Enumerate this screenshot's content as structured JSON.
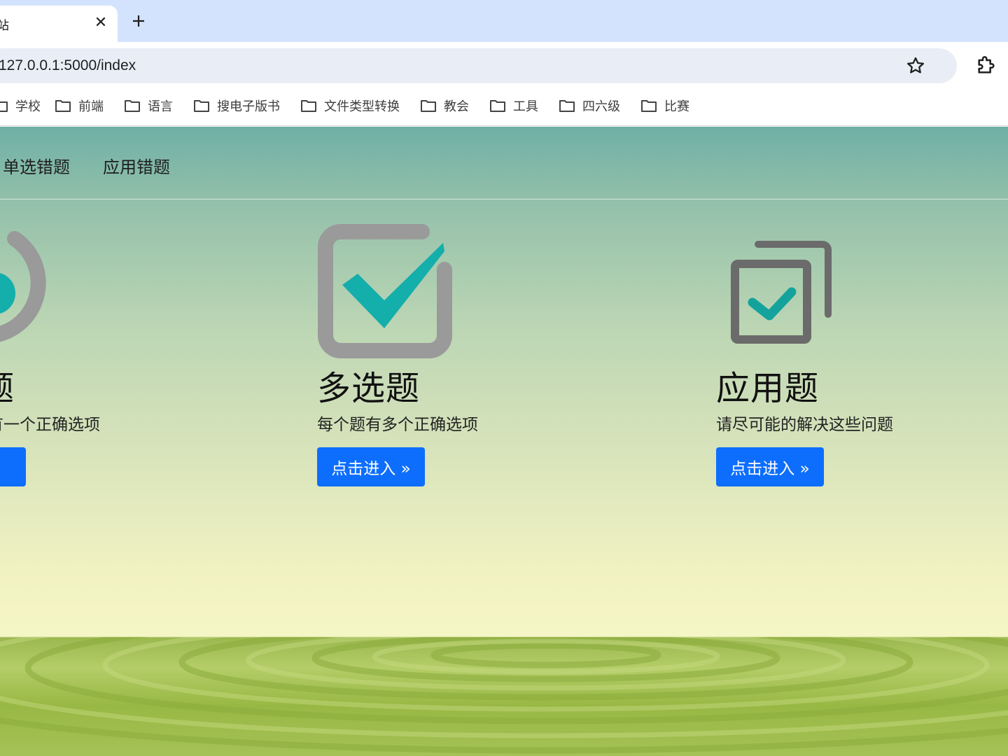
{
  "browser": {
    "tab_title": "站",
    "close_glyph": "✕",
    "url": "127.0.0.1:5000/index",
    "bookmarks": [
      "学校",
      "前端",
      "语言",
      "搜电子版书",
      "文件类型转换",
      "教会",
      "工具",
      "四六级",
      "比赛"
    ]
  },
  "nav": {
    "links": [
      "单选错题",
      "应用错题"
    ]
  },
  "cards": [
    {
      "title": "题",
      "desc": "有一个正确选项",
      "button": "»",
      "icon": "radio-icon"
    },
    {
      "title": "多选题",
      "desc": "每个题有多个正确选项",
      "button": "点击进入 »",
      "icon": "checkbox-icon"
    },
    {
      "title": "应用题",
      "desc": "请尽可能的解决这些问题",
      "button": "点击进入 »",
      "icon": "copy-check-icon"
    }
  ],
  "colors": {
    "primary_button": "#0d6efd",
    "icon_teal": "#14aeab",
    "icon_gray": "#9a9a9a",
    "icon_dark_gray": "#6b6b6b",
    "tabstrip": "#d3e3fd"
  }
}
